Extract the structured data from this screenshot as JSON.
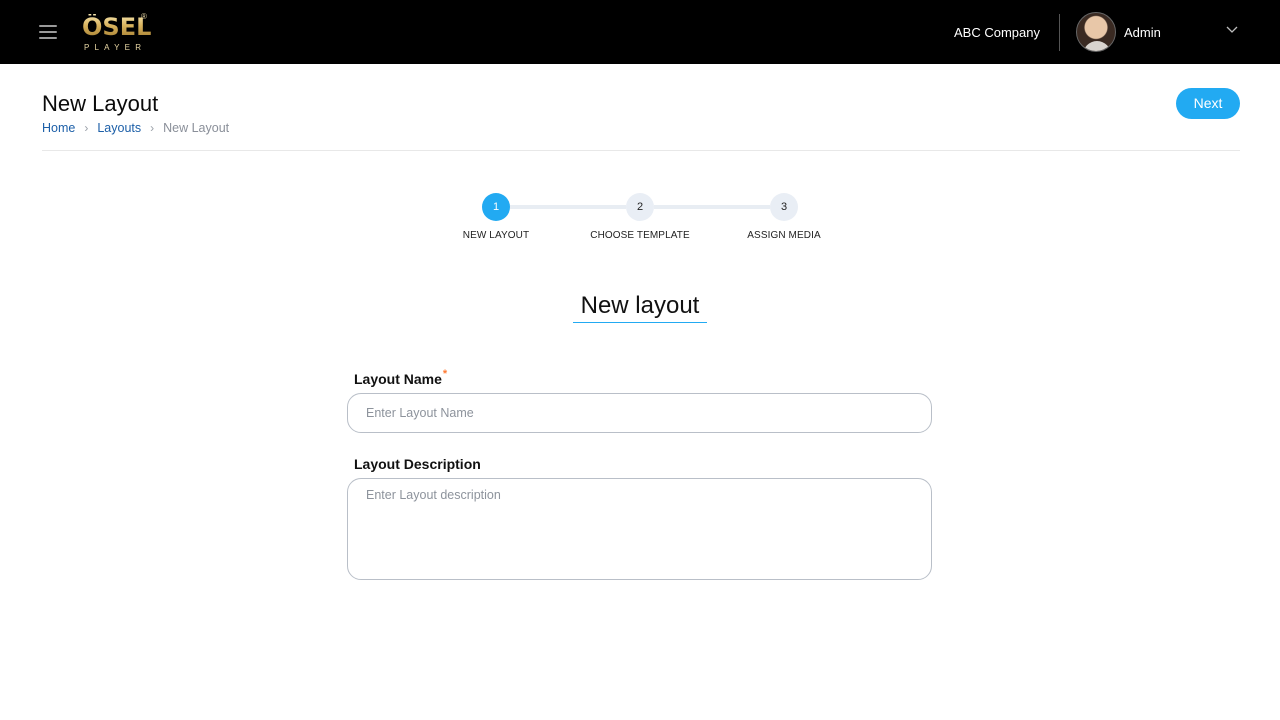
{
  "header": {
    "logo_text": "ÖSEL",
    "logo_sub": "PLAYER",
    "logo_reg": "®",
    "company": "ABC Company",
    "user_name": "Admin"
  },
  "page": {
    "title": "New Layout",
    "next_label": "Next",
    "breadcrumb": [
      {
        "label": "Home"
      },
      {
        "label": "Layouts"
      },
      {
        "label": "New Layout"
      }
    ]
  },
  "stepper": {
    "active_step": 1,
    "steps": [
      {
        "number": "1",
        "label": "NEW LAYOUT"
      },
      {
        "number": "2",
        "label": "CHOOSE TEMPLATE"
      },
      {
        "number": "3",
        "label": "ASSIGN MEDIA"
      }
    ]
  },
  "form": {
    "title": "New layout",
    "name_label": "Layout Name",
    "required_mark": "*",
    "name_placeholder": "Enter Layout Name",
    "name_value": "",
    "description_label": "Layout Description",
    "description_placeholder": "Enter Layout description",
    "description_value": ""
  },
  "colors": {
    "accent": "#22aaf2",
    "topbar": "#000000",
    "link": "#1c5fa8",
    "required": "#ff7a33"
  }
}
